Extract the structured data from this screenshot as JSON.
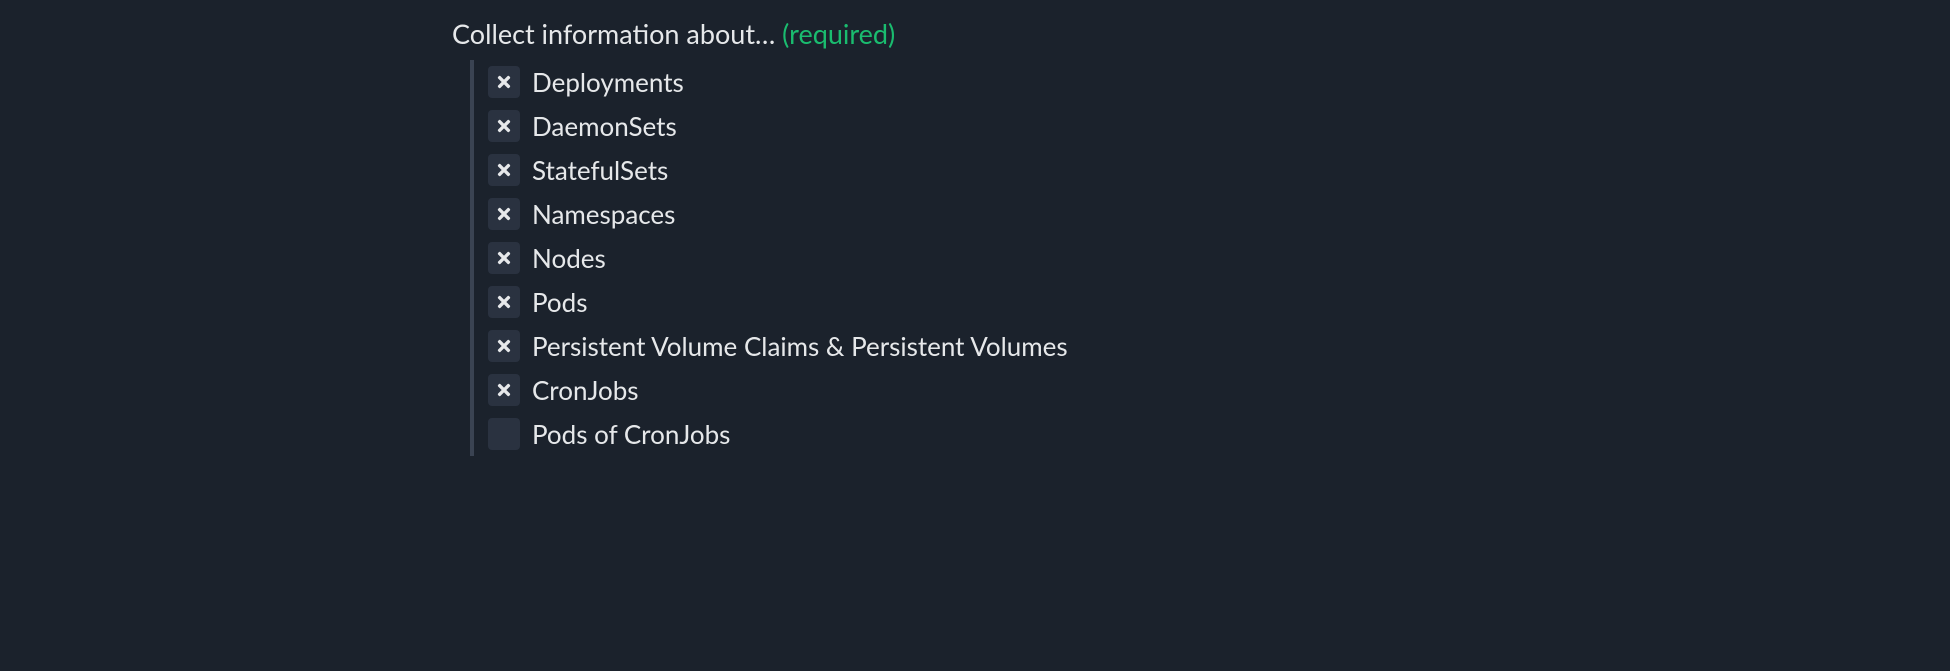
{
  "section": {
    "title": "Collect information about…",
    "required_suffix": "(required)"
  },
  "options": [
    {
      "id": "deployments",
      "label": "Deployments",
      "checked": true
    },
    {
      "id": "daemonsets",
      "label": "DaemonSets",
      "checked": true
    },
    {
      "id": "statefulsets",
      "label": "StatefulSets",
      "checked": true
    },
    {
      "id": "namespaces",
      "label": "Namespaces",
      "checked": true
    },
    {
      "id": "nodes",
      "label": "Nodes",
      "checked": true
    },
    {
      "id": "pods",
      "label": "Pods",
      "checked": true
    },
    {
      "id": "pvc-pv",
      "label": "Persistent Volume Claims & Persistent Volumes",
      "checked": true
    },
    {
      "id": "cronjobs",
      "label": "CronJobs",
      "checked": true
    },
    {
      "id": "pods-of-cron",
      "label": "Pods of CronJobs",
      "checked": false
    }
  ]
}
